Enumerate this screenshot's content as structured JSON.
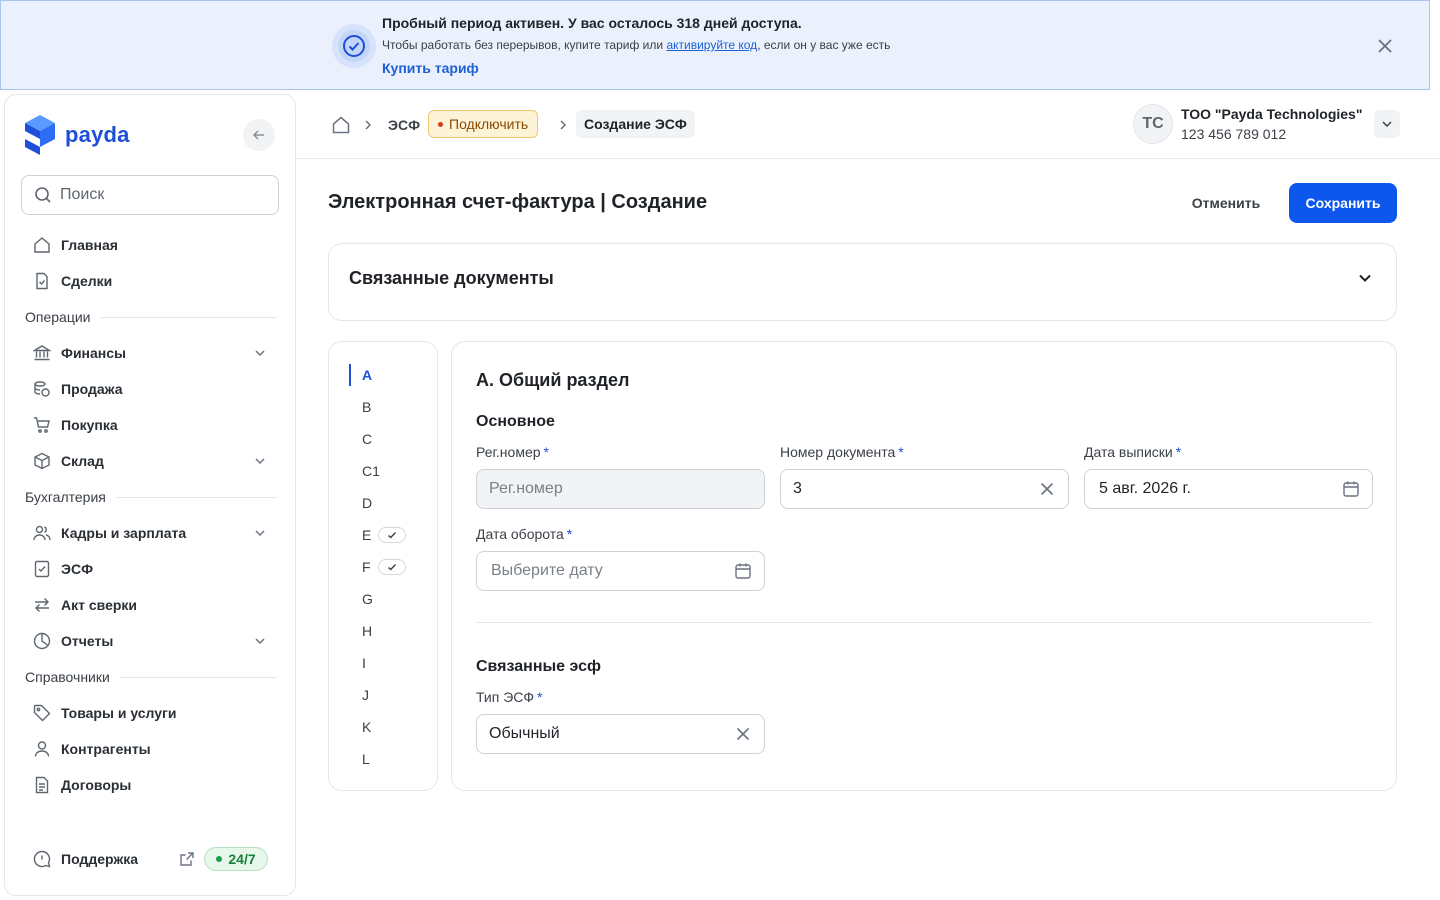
{
  "banner": {
    "title": "Пробный период активен. У вас осталось 318 дней доступа.",
    "text_before": "Чтобы работать без перерывов, купите тариф или ",
    "link": "активируйте код",
    "text_after": ", если он у вас уже есть",
    "buy": "Купить тариф"
  },
  "sidebar": {
    "logo": "payda",
    "search_placeholder": "Поиск",
    "items": [
      {
        "label": "Главная",
        "icon": "home-icon"
      },
      {
        "label": "Сделки",
        "icon": "document-check-icon"
      },
      {
        "label": "Финансы",
        "icon": "bank-icon"
      },
      {
        "label": "Продажа",
        "icon": "coins-icon"
      },
      {
        "label": "Покупка",
        "icon": "cart-icon"
      },
      {
        "label": "Склад",
        "icon": "box-icon"
      },
      {
        "label": "Кадры и зарплата",
        "icon": "users-icon"
      },
      {
        "label": "ЭСФ",
        "icon": "invoice-icon"
      },
      {
        "label": "Акт сверки",
        "icon": "arrows-swap-icon"
      },
      {
        "label": "Отчеты",
        "icon": "pie-chart-icon"
      },
      {
        "label": "Товары и услуги",
        "icon": "tag-icon"
      },
      {
        "label": "Контрагенты",
        "icon": "user-icon"
      },
      {
        "label": "Договоры",
        "icon": "contract-icon"
      }
    ],
    "sections": [
      "Операции",
      "Бухгалтерия",
      "Справочники"
    ],
    "support": "Поддержка",
    "support_badge": "24/7"
  },
  "header": {
    "crumb_esf": "ЭСФ",
    "connect": "Подключить",
    "current": "Создание ЭСФ",
    "avatar": "TC",
    "company_name": "ТОО \"Payda Technologies\"",
    "company_id": "123 456 789 012"
  },
  "page": {
    "title": "Электронная счет-фактура | Создание",
    "cancel": "Отменить",
    "save": "Сохранить",
    "linked_docs": "Связанные документы"
  },
  "steps": [
    "A",
    "B",
    "C",
    "C1",
    "D",
    "E",
    "F",
    "G",
    "H",
    "I",
    "J",
    "K",
    "L"
  ],
  "form": {
    "section_title": "A. Общий раздел",
    "basic": "Основное",
    "reg_label": "Рег.номер",
    "reg_placeholder": "Рег.номер",
    "docnum_label": "Номер документа",
    "docnum_value": "3",
    "issue_label": "Дата выписки",
    "issue_value": "5 авг. 2026 г.",
    "turnover_label": "Дата оборота",
    "turnover_placeholder": "Выберите дату",
    "linked_esf": "Связанные эсф",
    "type_label": "Тип ЭСФ",
    "type_value": "Обычный",
    "required_mark": "*"
  },
  "colors": {
    "primary": "#0d57ec",
    "accent": "#1d4fd8",
    "banner_bg": "#eaf1fc",
    "warning_bg": "#fdf3d6",
    "success": "#1f9d4a"
  }
}
